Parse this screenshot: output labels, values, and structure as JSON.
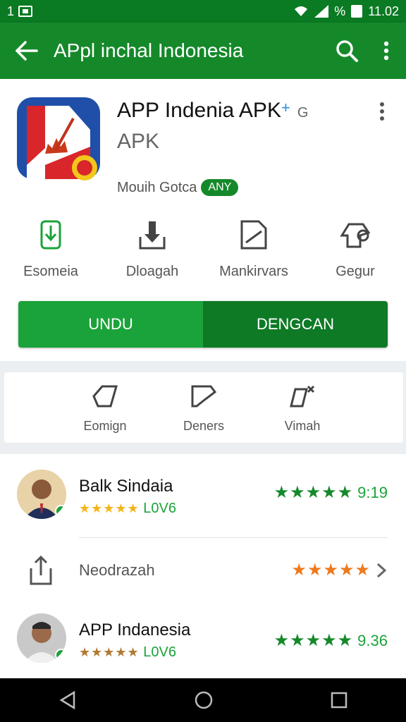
{
  "status_bar": {
    "left_text": "1",
    "right_text": "%",
    "time": "11.02"
  },
  "app_bar": {
    "title": "APpl inchal Indonesia"
  },
  "app": {
    "name": "APP Indenia APK",
    "name_suffix": "G",
    "subtitle": "APK",
    "developer": "Mouih Gotca",
    "badge": "ANY"
  },
  "actions": [
    {
      "label": "Esomeia",
      "icon": "phone-icon"
    },
    {
      "label": "Dloagah",
      "icon": "download-icon"
    },
    {
      "label": "Mankirvars",
      "icon": "edit-doc-icon"
    },
    {
      "label": "Gegur",
      "icon": "settings-tool-icon"
    }
  ],
  "buttons": {
    "primary": "UNDU",
    "secondary": "DENGCAN"
  },
  "secondary_actions": [
    {
      "label": "Eomign",
      "icon": "tag-icon"
    },
    {
      "label": "Deners",
      "icon": "draw-icon"
    },
    {
      "label": "Vimah",
      "icon": "wand-icon"
    }
  ],
  "reviews": [
    {
      "name": "Balk Sindaia",
      "stars_small": "★★★★★",
      "count": "L0V6",
      "stars_right": "★★★★★",
      "score": "9:19",
      "avatar": "avatar-1"
    },
    {
      "name": "Neodrazah",
      "stars_right": "★★★★★",
      "icon": "share-icon",
      "type": "link"
    },
    {
      "name": "APP Indanesia",
      "stars_small": "★★★★★",
      "count": "L0V6",
      "stars_right": "★★★★★",
      "score": "9.36",
      "avatar": "avatar-2"
    }
  ],
  "colors": {
    "primary": "#15892a",
    "accent_light": "#1aa33a",
    "accent_dark": "#0e7a26",
    "star_gold": "#f2b51a",
    "star_orange": "#ee7a1e"
  }
}
